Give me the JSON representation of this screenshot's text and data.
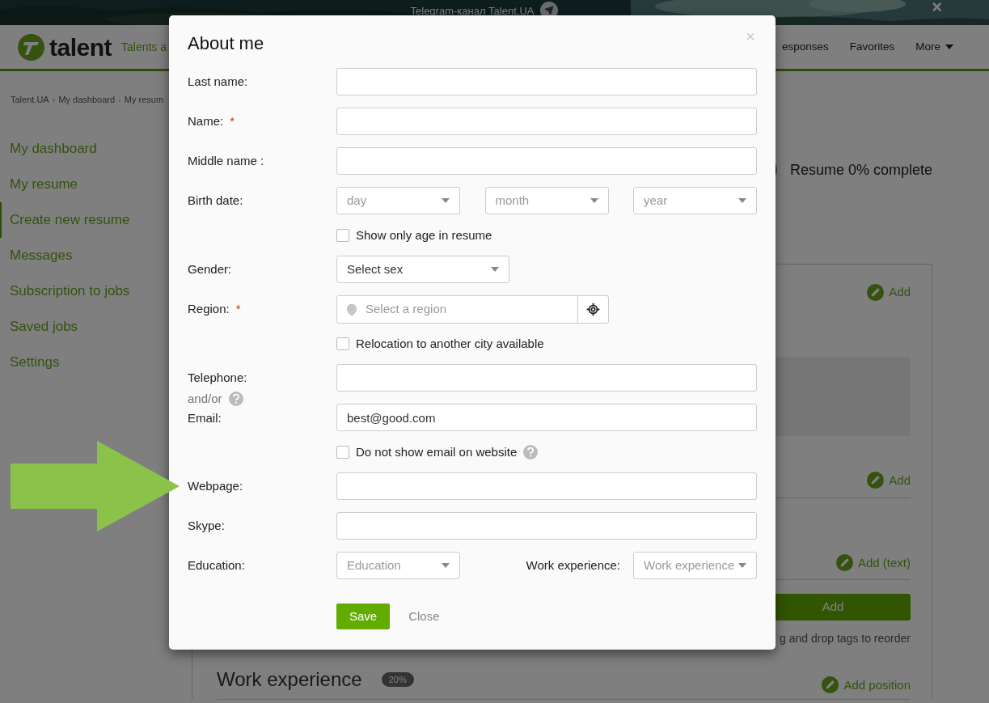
{
  "banner": {
    "text": "Telegram-канал Talent.UA",
    "close": "×"
  },
  "header": {
    "logo": "talent",
    "tagline": "Talents a",
    "nav": [
      {
        "label": "esponses",
        "dropdown": false
      },
      {
        "label": "Favorites",
        "dropdown": false
      },
      {
        "label": "More",
        "dropdown": true
      }
    ]
  },
  "breadcrumb": {
    "separator": "›",
    "items": [
      "Talent.UA",
      "My dashboard",
      "My resum"
    ]
  },
  "sidebar": {
    "items": [
      {
        "label": "My dashboard",
        "selected": false
      },
      {
        "label": "My resume",
        "selected": false
      },
      {
        "label": "Create new resume",
        "selected": true
      },
      {
        "label": "Messages",
        "selected": false
      },
      {
        "label": "Subscription to jobs",
        "selected": false
      },
      {
        "label": "Saved jobs",
        "selected": false
      },
      {
        "label": "Settings",
        "selected": false
      }
    ]
  },
  "progress": {
    "text": "Resume 0% complete"
  },
  "resume_card": {
    "actions": [
      "Add",
      "Add",
      "Add (text)"
    ],
    "add_button": "Add",
    "hint": "g and drop tags to reorder",
    "section": {
      "title": "Work experience",
      "badge": "20%",
      "action": "Add position"
    }
  },
  "dialog": {
    "title": "About me",
    "close": "×",
    "rows": [
      {
        "kind": "text",
        "label": "Last name:"
      },
      {
        "kind": "text",
        "label": "Name:",
        "required_mark": "*"
      },
      {
        "kind": "text",
        "label": "Middle name :"
      },
      {
        "kind": "date",
        "label": "Birth date:",
        "selects": [
          "day",
          "month",
          "year"
        ]
      },
      {
        "kind": "checkbox",
        "label": "Show only age in resume",
        "checked": false
      },
      {
        "kind": "select",
        "label": "Gender:",
        "value": "Select sex"
      },
      {
        "kind": "region",
        "label": "Region:",
        "required_mark": "*",
        "placeholder": "Select a region"
      },
      {
        "kind": "checkbox",
        "label": "Relocation to another city available",
        "checked": false
      },
      {
        "kind": "text",
        "label": "Telephone:"
      },
      {
        "kind": "text",
        "label": "Email:",
        "note": "and/or",
        "value": "best@good.com"
      },
      {
        "kind": "checkbox",
        "label": "Do not show email on website",
        "checked": false,
        "help": true
      },
      {
        "kind": "text",
        "label": "Webpage:"
      },
      {
        "kind": "text",
        "label": "Skype:"
      },
      {
        "kind": "pair",
        "label": "Education:",
        "placeholder": "Education",
        "label2": "Work experience:",
        "placeholder2": "Work experience"
      }
    ],
    "buttons": {
      "save": "Save",
      "close": "Close"
    }
  }
}
